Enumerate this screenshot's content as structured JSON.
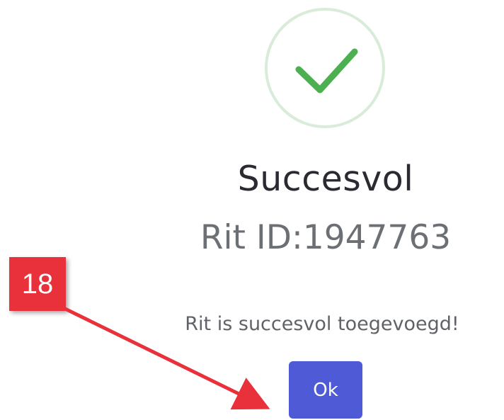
{
  "dialog": {
    "icon": "checkmark-icon",
    "title": "Succesvol",
    "subtitle": "Rit ID:1947763",
    "message": "Rit is succesvol toegevoegd!",
    "ok_label": "Ok"
  },
  "annotation": {
    "step_number": "18",
    "badge_color": "#e8313a"
  },
  "colors": {
    "success_green": "#4caf50",
    "ring_green": "#d8ecd9",
    "button_blue": "#4f5ad6"
  }
}
